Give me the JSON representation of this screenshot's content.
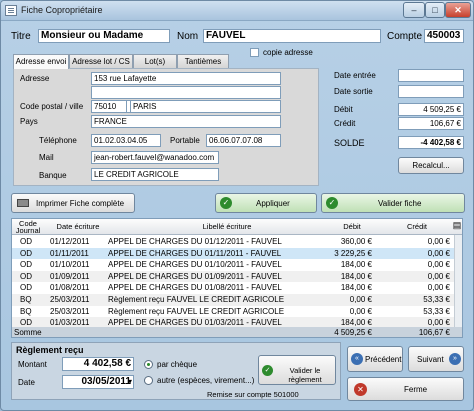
{
  "window": {
    "title": "Fiche Copropriétaire",
    "minimize": "–",
    "maximize": "□",
    "close": "✕"
  },
  "header": {
    "titre_label": "Titre",
    "titre_value": "Monsieur ou Madame",
    "nom_label": "Nom",
    "nom_value": "FAUVEL",
    "compte_label": "Compte",
    "compte_value": "450003"
  },
  "tabs": [
    "Adresse envoi",
    "Adresse lot / CS",
    "Lot(s)",
    "Tantièmes"
  ],
  "copie_adresse": "copie adresse",
  "address": {
    "adresse_label": "Adresse",
    "adresse_line1": "153 rue Lafayette",
    "adresse_line2": "",
    "adresse_line3": "",
    "cp_label": "Code postal / ville",
    "cp_value": "75010",
    "ville_value": "PARIS",
    "pays_label": "Pays",
    "pays_value": "FRANCE",
    "tel_label": "Téléphone",
    "tel_value": "01.02.03.04.05",
    "portable_label": "Portable",
    "portable_value": "06.06.07.07.08",
    "mail_label": "Mail",
    "mail_value": "jean-robert.fauvel@wanadoo.com",
    "banque_label": "Banque",
    "banque_value": "LE CREDIT AGRICOLE"
  },
  "right": {
    "date_entree_label": "Date entrée",
    "date_entree_value": "",
    "date_sortie_label": "Date sortie",
    "date_sortie_value": "",
    "debit_label": "Débit",
    "debit_value": "4 509,25 €",
    "credit_label": "Crédit",
    "credit_value": "106,67 €",
    "solde_label": "SOLDE",
    "solde_value": "-4 402,58 €",
    "recalcul_label": "Recalcul..."
  },
  "actions": {
    "imprimer": "Imprimer Fiche complète",
    "appliquer": "Appliquer",
    "valider": "Valider fiche"
  },
  "table": {
    "headers": [
      "Code Journal",
      "Date écriture",
      "Libellé écriture",
      "Débit",
      "Crédit"
    ],
    "rows": [
      [
        "OD",
        "01/12/2011",
        "APPEL DE CHARGES DU 01/12/2011 - FAUVEL",
        "360,00 €",
        "0,00 €"
      ],
      [
        "OD",
        "01/11/2011",
        "APPEL DE CHARGES DU 01/11/2011 - FAUVEL",
        "3 229,25 €",
        "0,00 €"
      ],
      [
        "OD",
        "01/10/2011",
        "APPEL DE CHARGES DU 01/10/2011 - FAUVEL",
        "184,00 €",
        "0,00 €"
      ],
      [
        "OD",
        "01/09/2011",
        "APPEL DE CHARGES DU 01/09/2011 - FAUVEL",
        "184,00 €",
        "0,00 €"
      ],
      [
        "OD",
        "01/08/2011",
        "APPEL DE CHARGES DU 01/08/2011 - FAUVEL",
        "184,00 €",
        "0,00 €"
      ],
      [
        "BQ",
        "25/03/2011",
        "Règlement reçu FAUVEL          LE CREDIT AGRICOLE",
        "0,00 €",
        "53,33 €"
      ],
      [
        "BQ",
        "25/03/2011",
        "Règlement reçu FAUVEL          LE CREDIT AGRICOLE",
        "0,00 €",
        "53,33 €"
      ],
      [
        "OD",
        "01/03/2011",
        "APPEL DE CHARGES DU 01/03/2011 - FAUVEL",
        "184,00 €",
        "0,00 €"
      ]
    ],
    "somme_label": "Somme",
    "somme_debit": "4 509,25 €",
    "somme_credit": "106,67 €"
  },
  "reglement": {
    "title": "Règlement reçu",
    "montant_label": "Montant",
    "montant_value": "4 402,58 €",
    "date_label": "Date",
    "date_value": "03/05/2011",
    "par_cheque": "par chèque",
    "autre": "autre (espèces, virement...)",
    "valider_label": "Valider le règlement",
    "remise_label": "Remise sur compte 501000"
  },
  "nav": {
    "precedent": "Précédent",
    "suivant": "Suivant",
    "ferme": "Ferme"
  },
  "colors": {
    "green": "#2e8b2e",
    "red": "#c0392b",
    "blue": "#3b6fb3",
    "selected_row": "#cfe6f7"
  }
}
